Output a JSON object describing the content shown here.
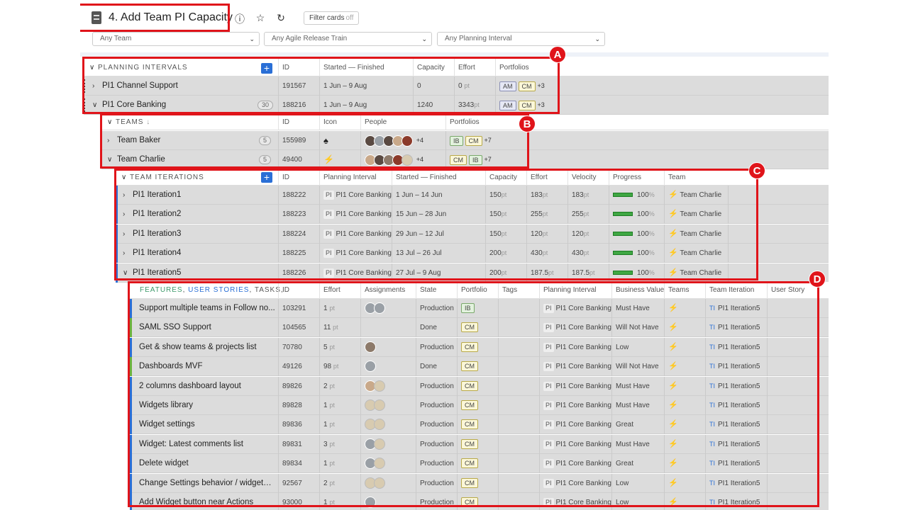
{
  "page": {
    "title": "4. Add Team PI Capacity",
    "filter_cards_label": "Filter cards",
    "filter_cards_state": "off",
    "filters": [
      "Any Team",
      "Any Agile Release Train",
      "Any Planning Interval"
    ]
  },
  "planning_intervals": {
    "section_label": "PLANNING INTERVALS",
    "columns": [
      "ID",
      "Started — Finished",
      "Capacity",
      "Effort",
      "Portfolios"
    ],
    "rows": [
      {
        "name": "PI1 Channel Support",
        "count": "",
        "id": "191567",
        "dates": "1 Jun – 9 Aug",
        "capacity": "0",
        "effort": "0",
        "effort_unit": "pt",
        "portfolios": [
          "AM",
          "CM"
        ],
        "more": "+3",
        "expanded": false
      },
      {
        "name": "PI1 Core Banking",
        "count": "30",
        "id": "188216",
        "dates": "1 Jun – 9 Aug",
        "capacity": "1240",
        "effort": "3343",
        "effort_unit": "pt",
        "portfolios": [
          "AM",
          "CM"
        ],
        "more": "+3",
        "expanded": true
      }
    ]
  },
  "teams": {
    "section_label": "TEAMS",
    "columns": [
      "ID",
      "Icon",
      "People",
      "Portfolios"
    ],
    "rows": [
      {
        "name": "Team Baker",
        "count": "5",
        "id": "155989",
        "icon": "♠",
        "people_more": "+4",
        "portfolios": [
          "IB",
          "CM"
        ],
        "more": "+7"
      },
      {
        "name": "Team Charlie",
        "count": "5",
        "id": "49400",
        "icon": "⚡",
        "people_more": "+4",
        "portfolios": [
          "CM",
          "IB"
        ],
        "more": "+7"
      }
    ]
  },
  "team_iterations": {
    "section_label": "TEAM ITERATIONS",
    "columns": [
      "ID",
      "Planning Interval",
      "Started — Finished",
      "Capacity",
      "Effort",
      "Velocity",
      "Progress",
      "Team"
    ],
    "pi_prefix": "PI",
    "unit": "pt",
    "rows": [
      {
        "name": "PI1 Iteration1",
        "id": "188222",
        "pi": "PI1 Core Banking",
        "dates": "1 Jun – 14 Jun",
        "capacity": "150",
        "effort": "183",
        "velocity": "183",
        "progress": "100",
        "team": "Team Charlie"
      },
      {
        "name": "PI1 Iteration2",
        "id": "188223",
        "pi": "PI1 Core Banking",
        "dates": "15 Jun – 28 Jun",
        "capacity": "150",
        "effort": "255",
        "velocity": "255",
        "progress": "100",
        "team": "Team Charlie"
      },
      {
        "name": "PI1 Iteration3",
        "id": "188224",
        "pi": "PI1 Core Banking",
        "dates": "29 Jun – 12 Jul",
        "capacity": "150",
        "effort": "120",
        "velocity": "120",
        "progress": "100",
        "team": "Team Charlie"
      },
      {
        "name": "PI1 Iteration4",
        "id": "188225",
        "pi": "PI1 Core Banking",
        "dates": "13 Jul – 26 Jul",
        "capacity": "200",
        "effort": "430",
        "velocity": "430",
        "progress": "100",
        "team": "Team Charlie"
      },
      {
        "name": "PI1 Iteration5",
        "id": "188226",
        "pi": "PI1 Core Banking",
        "dates": "27 Jul – 9 Aug",
        "capacity": "200",
        "effort": "187.5",
        "velocity": "187.5",
        "progress": "100",
        "team": "Team Charlie"
      }
    ]
  },
  "features": {
    "section_parts": [
      "FEATURES",
      "USER STORIES",
      "TASKS"
    ],
    "columns": [
      "ID",
      "Effort",
      "Assignments",
      "State",
      "Portfolio",
      "Tags",
      "Planning Interval",
      "Business Value",
      "Teams",
      "Team Iteration",
      "User Story"
    ],
    "pi_prefix": "PI",
    "ti_prefix": "TI",
    "unit": "pt",
    "rows": [
      {
        "name": "Support multiple teams in Follow no...",
        "id": "103291",
        "effort": "1",
        "state": "Production",
        "portfolio": "IB",
        "pi": "PI1 Core Banking",
        "bv": "Must Have",
        "ti": "PI1 Iteration5",
        "stripe": "blue"
      },
      {
        "name": "SAML SSO Support",
        "id": "104565",
        "effort": "11",
        "state": "Done",
        "portfolio": "CM",
        "pi": "PI1 Core Banking",
        "bv": "Will Not Have",
        "ti": "PI1 Iteration5",
        "stripe": "green"
      },
      {
        "name": "Get & show teams & projects list",
        "id": "70780",
        "effort": "5",
        "state": "Production",
        "portfolio": "CM",
        "pi": "PI1 Core Banking",
        "bv": "Low",
        "ti": "PI1 Iteration5",
        "stripe": "blue"
      },
      {
        "name": "Dashboards MVF",
        "id": "49126",
        "effort": "98",
        "state": "Done",
        "portfolio": "CM",
        "pi": "PI1 Core Banking",
        "bv": "Will Not Have",
        "ti": "PI1 Iteration5",
        "stripe": "green"
      },
      {
        "name": "2 columns dashboard layout",
        "id": "89826",
        "effort": "2",
        "state": "Production",
        "portfolio": "CM",
        "pi": "PI1 Core Banking",
        "bv": "Must Have",
        "ti": "PI1 Iteration5",
        "stripe": "blue"
      },
      {
        "name": "Widgets library",
        "id": "89828",
        "effort": "1",
        "state": "Production",
        "portfolio": "CM",
        "pi": "PI1 Core Banking",
        "bv": "Must Have",
        "ti": "PI1 Iteration5",
        "stripe": "blue"
      },
      {
        "name": "Widget settings",
        "id": "89836",
        "effort": "1",
        "state": "Production",
        "portfolio": "CM",
        "pi": "PI1 Core Banking",
        "bv": "Great",
        "ti": "PI1 Iteration5",
        "stripe": "blue"
      },
      {
        "name": "Widget: Latest comments list",
        "id": "89831",
        "effort": "3",
        "state": "Production",
        "portfolio": "CM",
        "pi": "PI1 Core Banking",
        "bv": "Must Have",
        "ti": "PI1 Iteration5",
        "stripe": "blue"
      },
      {
        "name": "Delete widget",
        "id": "89834",
        "effort": "1",
        "state": "Production",
        "portfolio": "CM",
        "pi": "PI1 Core Banking",
        "bv": "Great",
        "ti": "PI1 Iteration5",
        "stripe": "blue"
      },
      {
        "name": "Change Settings behavior / widgets ...",
        "id": "92567",
        "effort": "2",
        "state": "Production",
        "portfolio": "CM",
        "pi": "PI1 Core Banking",
        "bv": "Low",
        "ti": "PI1 Iteration5",
        "stripe": "blue"
      },
      {
        "name": "Add Widget button near Actions",
        "id": "93000",
        "effort": "1",
        "state": "Production",
        "portfolio": "CM",
        "pi": "PI1 Core Banking",
        "bv": "Low",
        "ti": "PI1 Iteration5",
        "stripe": "blue"
      }
    ]
  },
  "callouts": [
    "A",
    "B",
    "C",
    "D"
  ],
  "colors": {
    "highlight": "#e0141a",
    "accent": "#2a6fd6",
    "progress": "#3fa743",
    "team_icon": "#f4a424"
  }
}
